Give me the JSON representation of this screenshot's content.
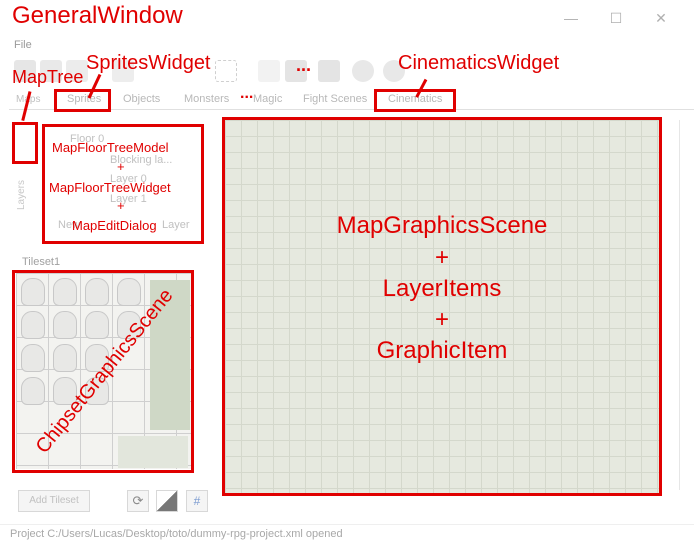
{
  "window": {
    "title": "GeneralWindow",
    "menu_file": "File",
    "minimize": "—",
    "maximize": "☐",
    "close": "✕"
  },
  "annotations": {
    "sprites_widget": "SpritesWidget",
    "cinematics_widget": "CinematicsWidget",
    "map_tree": "MapTree",
    "ellipsis_toolbar": "...",
    "ellipsis_tabs": "...",
    "floor_model": "MapFloorTreeModel",
    "plus1": "+",
    "floor_widget": "MapFloorTreeWidget",
    "plus2": "+",
    "edit_dialog": "MapEditDialog",
    "chipset_scene": "ChipsetGraphicsScene",
    "map_scene_line1": "MapGraphicsScene",
    "map_scene_plus1": "+",
    "map_scene_line2": "LayerItems",
    "map_scene_plus2": "+",
    "map_scene_line3": "GraphicItem"
  },
  "tabs": [
    "Sprites",
    "Objects",
    "Monsters",
    "Magic",
    "Fight Scenes",
    "Cinematics"
  ],
  "left_tabs": {
    "maps": "Maps",
    "layers": "Layers",
    "map_label": "Ma"
  },
  "tree": {
    "floor": "Floor 0",
    "blocking": "Blocking la...",
    "layer0": "Layer 0",
    "layer1": "Layer 1",
    "new_btn": "New",
    "layer_btn": "Layer"
  },
  "tileset": {
    "tab": "Tileset1",
    "add_button": "Add Tileset"
  },
  "status": "Project C:/Users/Lucas/Desktop/toto/dummy-rpg-project.xml opened"
}
